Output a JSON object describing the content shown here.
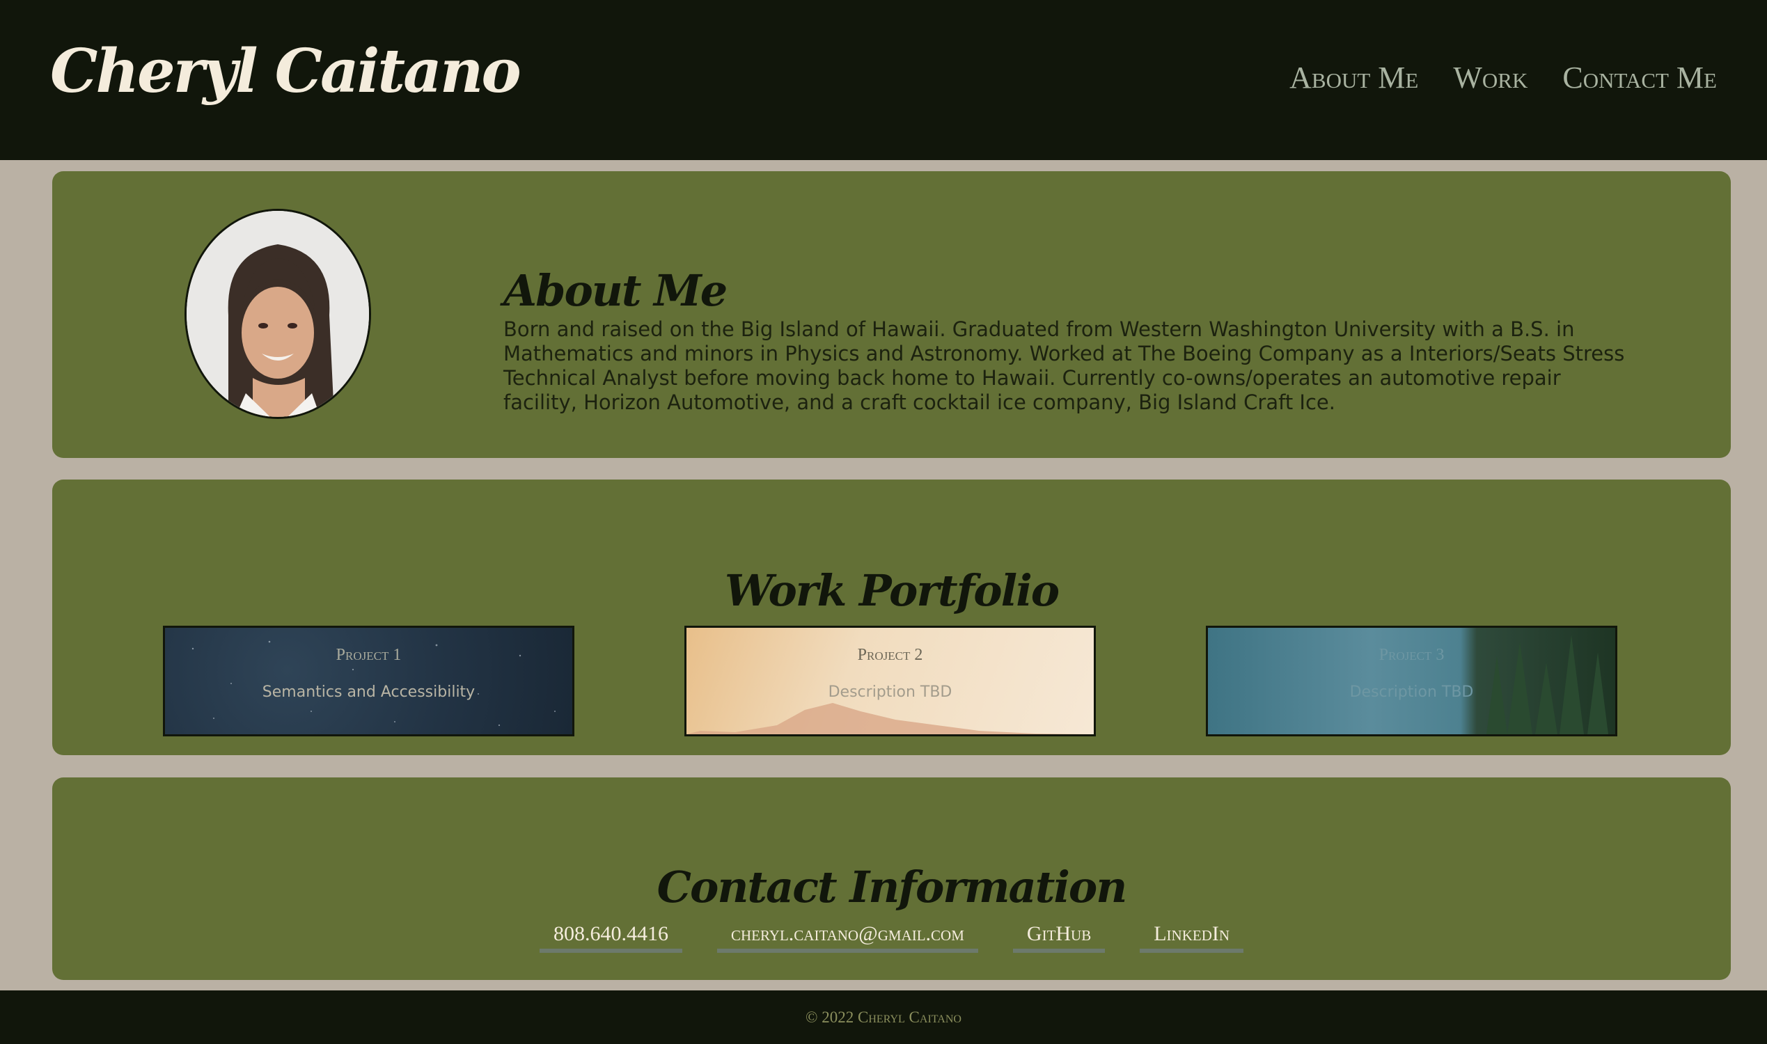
{
  "header": {
    "logo": "Cheryl Caitano",
    "nav": [
      "About Me",
      "Work",
      "Contact Me"
    ]
  },
  "about": {
    "title": "About Me",
    "body": "Born and raised on the Big Island of Hawaii. Graduated from Western Washington University with a B.S. in Mathematics and minors in Physics and Astronomy. Worked at The Boeing Company as a Interiors/Seats Stress Technical Analyst before moving back home to Hawaii. Currently co-owns/operates an automotive repair facility, Horizon Automotive, and a craft cocktail ice company, Big Island Craft Ice."
  },
  "work": {
    "title": "Work Portfolio",
    "projects": [
      {
        "title": "Project 1",
        "description": "Semantics and Accessibility"
      },
      {
        "title": "Project 2",
        "description": "Description TBD"
      },
      {
        "title": "Project 3",
        "description": "Description TBD"
      }
    ]
  },
  "contact": {
    "title": "Contact Information",
    "links": [
      "808.640.4416",
      "cheryl.caitano@gmail.com",
      "GitHub",
      "LinkedIn"
    ]
  },
  "footer": {
    "copyright": "© 2022 Cheryl Caitano"
  },
  "colors": {
    "header_bg": "#11160b",
    "page_bg": "#bab1a4",
    "card_bg": "#637036",
    "text_light": "#f4ecdc"
  }
}
